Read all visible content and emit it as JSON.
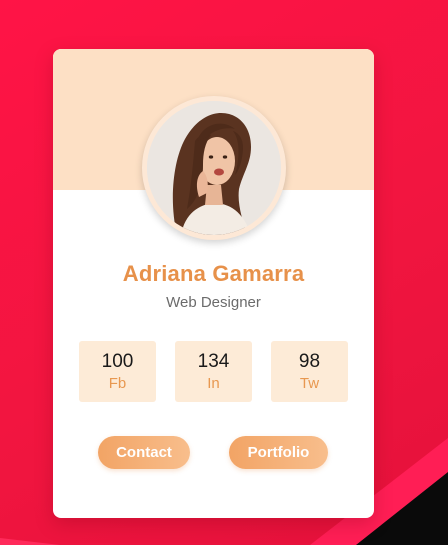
{
  "profile": {
    "name": "Adriana Gamarra",
    "role": "Web Designer",
    "avatar": "woman-portrait"
  },
  "stats": [
    {
      "value": "100",
      "label": "Fb"
    },
    {
      "value": "134",
      "label": "In"
    },
    {
      "value": "98",
      "label": "Tw"
    }
  ],
  "buttons": {
    "contact": "Contact",
    "portfolio": "Portfolio"
  },
  "colors": {
    "background": "#f01a47",
    "card_header": "#fde0c5",
    "name": "#e7914a",
    "stat_box": "#fdebd7",
    "stat_label": "#e89850",
    "button_start": "#f2a465",
    "button_end": "#f8be8c"
  }
}
